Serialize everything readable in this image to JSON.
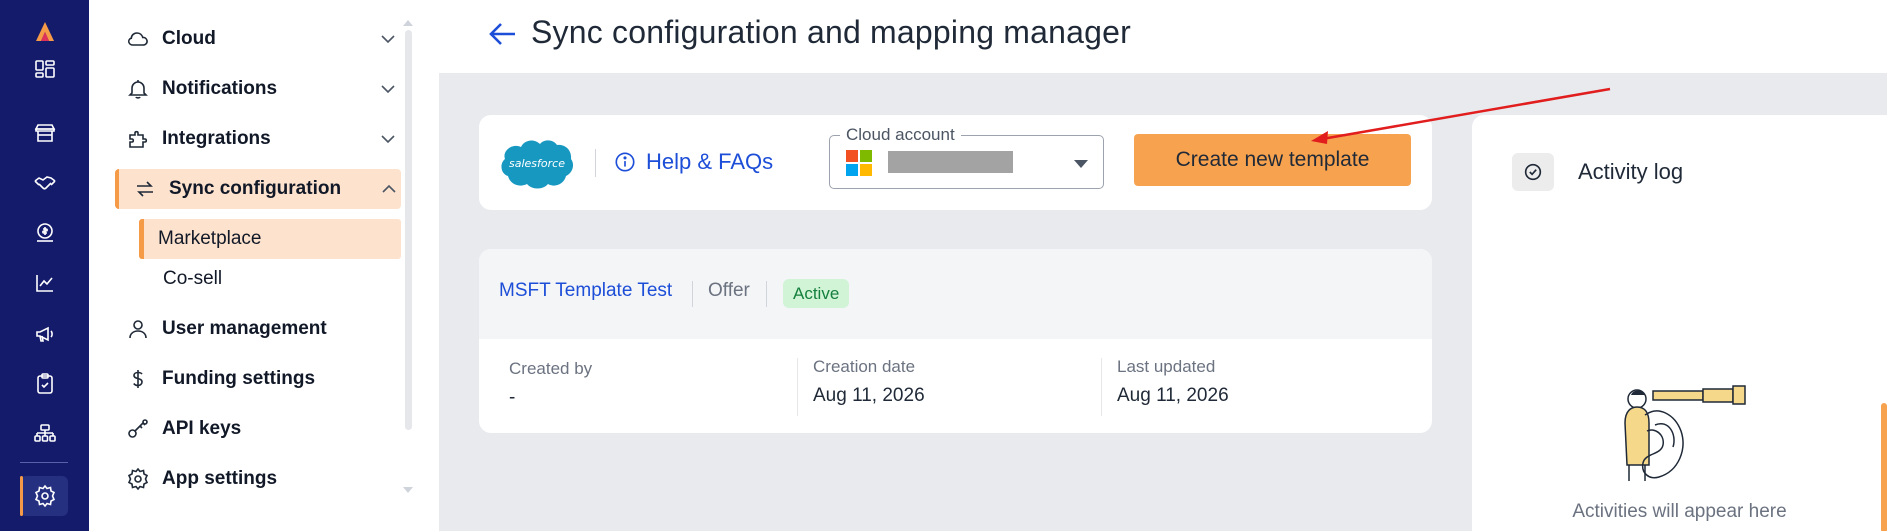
{
  "rail": {
    "items": [
      {
        "icon": "brand-logo-icon"
      },
      {
        "icon": "dashboard-icon"
      },
      {
        "icon": "store-icon"
      },
      {
        "icon": "handshake-icon"
      },
      {
        "icon": "money-icon"
      },
      {
        "icon": "chart-line-icon"
      },
      {
        "icon": "megaphone-icon"
      },
      {
        "icon": "clipboard-check-icon"
      },
      {
        "icon": "org-chart-icon"
      },
      {
        "icon": "gear-icon"
      }
    ],
    "accent": "#f59a47",
    "background": "#141b6b"
  },
  "menu": {
    "items": [
      {
        "label": "Cloud",
        "icon": "cloud-icon",
        "expandable": true
      },
      {
        "label": "Notifications",
        "icon": "bell-icon",
        "expandable": true
      },
      {
        "label": "Integrations",
        "icon": "puzzle-icon",
        "expandable": true
      },
      {
        "label": "Sync configuration",
        "icon": "sync-icon",
        "expandable": true,
        "expanded": true
      },
      {
        "label": "User management",
        "icon": "user-icon"
      },
      {
        "label": "Funding settings",
        "icon": "dollar-icon"
      },
      {
        "label": "API keys",
        "icon": "key-icon"
      },
      {
        "label": "App settings",
        "icon": "gear-icon"
      }
    ],
    "sync_submenu": [
      {
        "label": "Marketplace",
        "active": true
      },
      {
        "label": "Co-sell"
      }
    ]
  },
  "header": {
    "title": "Sync configuration and mapping manager"
  },
  "toolbar": {
    "help_label": "Help & FAQs",
    "cloud_account_label": "Cloud account",
    "create_button_label": "Create new template",
    "salesforce_logo_text": "salesforce"
  },
  "template": {
    "name": "MSFT Template Test",
    "type": "Offer",
    "status": "Active",
    "created_by_label": "Created by",
    "created_by_value": "-",
    "creation_date_label": "Creation date",
    "creation_date_value": "Aug 11, 2026",
    "last_updated_label": "Last updated",
    "last_updated_value": "Aug 11, 2026"
  },
  "activity": {
    "title": "Activity log",
    "empty_message": "Activities will appear here"
  },
  "colors": {
    "accent_orange": "#f7a24f",
    "link_blue": "#1d4ed8",
    "status_green_bg": "#d1f4d6",
    "status_green_text": "#15803d",
    "annotation_red": "#e11d1d"
  }
}
